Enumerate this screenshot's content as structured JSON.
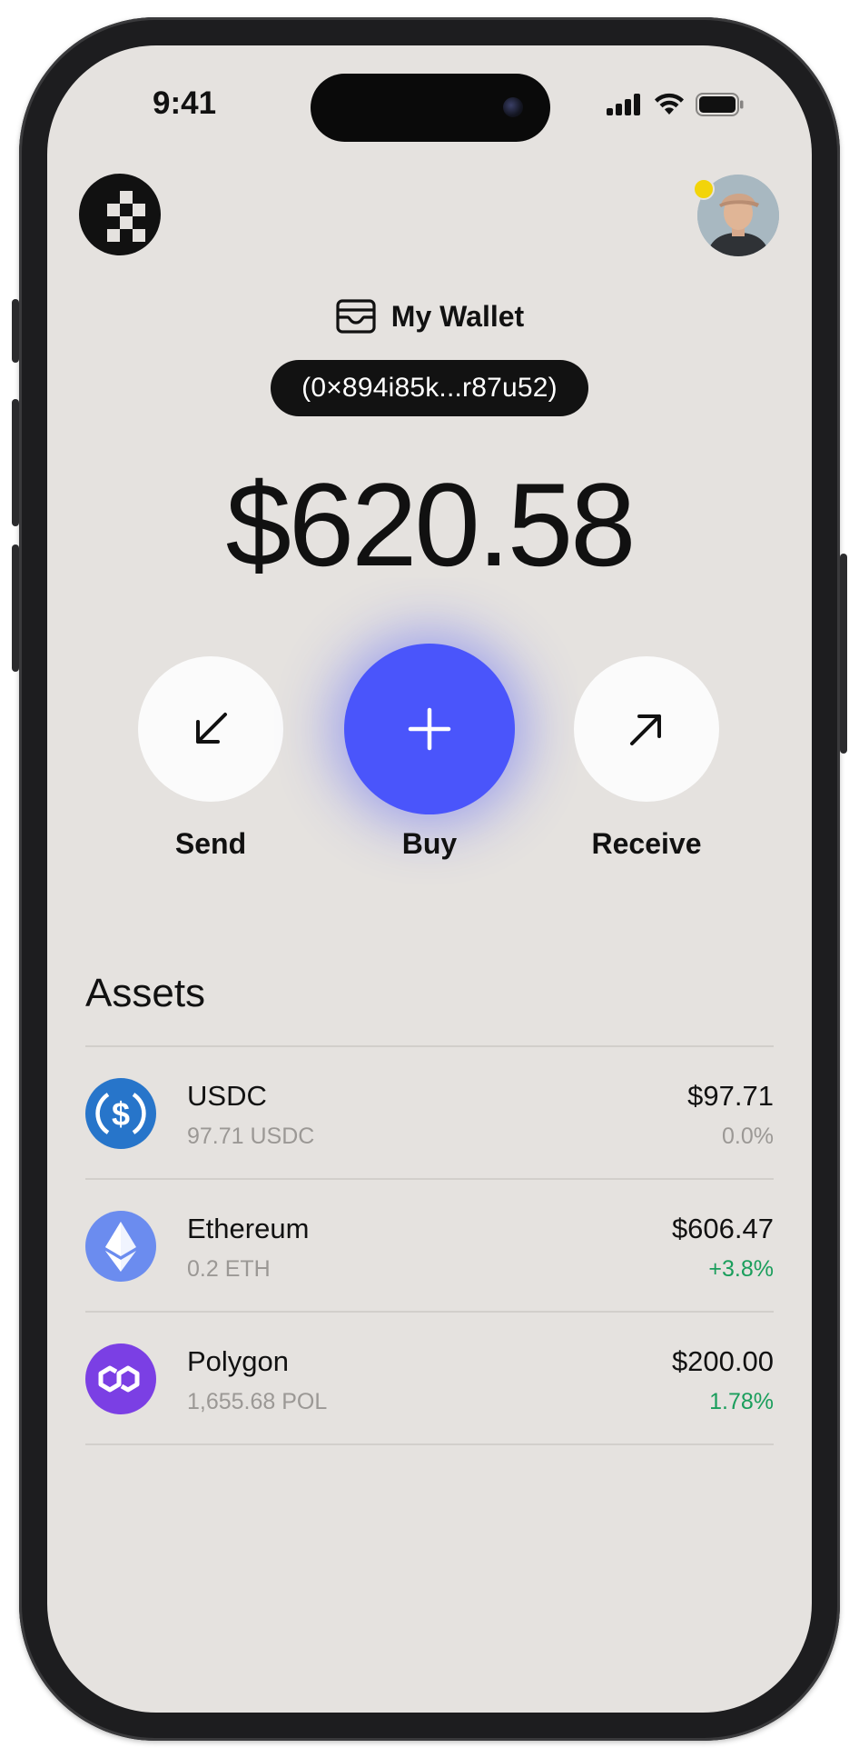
{
  "status_bar": {
    "time": "9:41"
  },
  "wallet": {
    "title": "My Wallet",
    "address": "(0×894i85k...r87u52)",
    "balance": "$620.58"
  },
  "actions": [
    {
      "label": "Send",
      "icon": "arrow-down-left-icon"
    },
    {
      "label": "Buy",
      "icon": "plus-icon"
    },
    {
      "label": "Receive",
      "icon": "arrow-up-right-icon"
    }
  ],
  "assets": {
    "title": "Assets",
    "items": [
      {
        "name": "USDC",
        "amount": "97.71 USDC",
        "value": "$97.71",
        "change": "0.0%",
        "icon": "usdc-icon",
        "change_color": "#9b9895",
        "icon_color": "#2775ca"
      },
      {
        "name": "Ethereum",
        "amount": "0.2 ETH",
        "value": "$606.47",
        "change": "+3.8%",
        "icon": "ethereum-icon",
        "change_color": "#1a9e5c",
        "icon_color": "#6b8cef"
      },
      {
        "name": "Polygon",
        "amount": "1,655.68 POL",
        "value": "$200.00",
        "change": "1.78%",
        "icon": "polygon-icon",
        "change_color": "#1a9e5c",
        "icon_color": "#7b3fe4"
      }
    ]
  },
  "colors": {
    "background": "#e5e2df",
    "accent": "#4a55fb",
    "notification_dot": "#f2d40a"
  }
}
